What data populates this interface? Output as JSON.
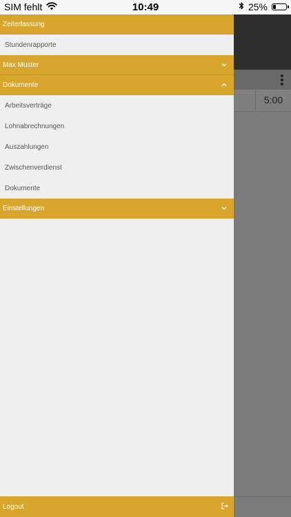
{
  "status_bar": {
    "carrier": "SIM fehlt",
    "time": "10:49",
    "battery": "25%",
    "battery_level": 0.25
  },
  "background": {
    "time_value": "5:00"
  },
  "drawer": {
    "sections": [
      {
        "title": "Zeiterfassung",
        "expanded": true,
        "items": [
          "Stundenrapporte"
        ]
      },
      {
        "title": "Max Muster",
        "expanded": false,
        "items": []
      },
      {
        "title": "Dokumente",
        "expanded": true,
        "items": [
          "Arbeitsverträge",
          "Lohnabrechnungen",
          "Auszahlungen",
          "Zwischenverdienst",
          "Dokumente"
        ]
      },
      {
        "title": "Einstellungen",
        "expanded": false,
        "items": []
      }
    ],
    "logout_label": "Logout"
  },
  "colors": {
    "accent": "#d8a62c",
    "drawer_bg": "#efefef",
    "header_dark": "#2e2e2e"
  },
  "icons": {
    "wifi": "wifi-icon",
    "bluetooth": "bluetooth-icon",
    "battery": "battery-icon",
    "chevron_down": "chevron-down-icon",
    "chevron_up": "chevron-up-icon",
    "logout": "logout-icon",
    "more": "more-vertical-icon"
  }
}
